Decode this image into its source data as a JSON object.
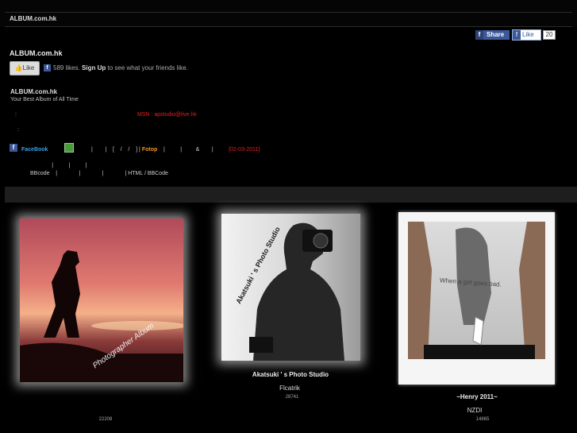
{
  "header": {
    "site_title": "ALBUM.com.hk"
  },
  "facebook": {
    "share_label": "Share",
    "like_label": "Like",
    "like_count": "20",
    "f_glyph": "f"
  },
  "page": {
    "title": "ALBUM.com.hk",
    "like_button": "Like",
    "likes_text": "589 likes.",
    "signup": "Sign Up",
    "signup_rest": "to see what your friends like.",
    "site_name": "ALBUM.com.hk",
    "tagline": "Your Best Album of All Time",
    "msn": "MSN : apstudio@live.hk",
    "colon": ":"
  },
  "nav": {
    "facebook": "FaceBook",
    "segment1": "|        |    [    /    /    ] | ",
    "fotop": "Fotop",
    "segment2": "    |          |         &        |          ",
    "date": "[02-03-2011]",
    "row2": "              |          |          |",
    "row3": "BBcode    |              |              |              | HTML / BBCode"
  },
  "albums": [
    {
      "name": "Photographer Album",
      "title": "",
      "sub": "",
      "count": "22208"
    },
    {
      "name": "Akatsuki ' s Photo Studio",
      "title": "Akatsuki ' s Photo Studio",
      "sub": "Flcatrik",
      "count": "28741"
    },
    {
      "name": "When a girl goes bad.",
      "title": "~Henry           2011~",
      "sub": "NZDI",
      "count": "14865"
    }
  ],
  "colors": {
    "facebook_blue": "#3b5998",
    "red": "#e32020",
    "orange": "#f29a1b",
    "link_blue": "#3aa0ea"
  }
}
